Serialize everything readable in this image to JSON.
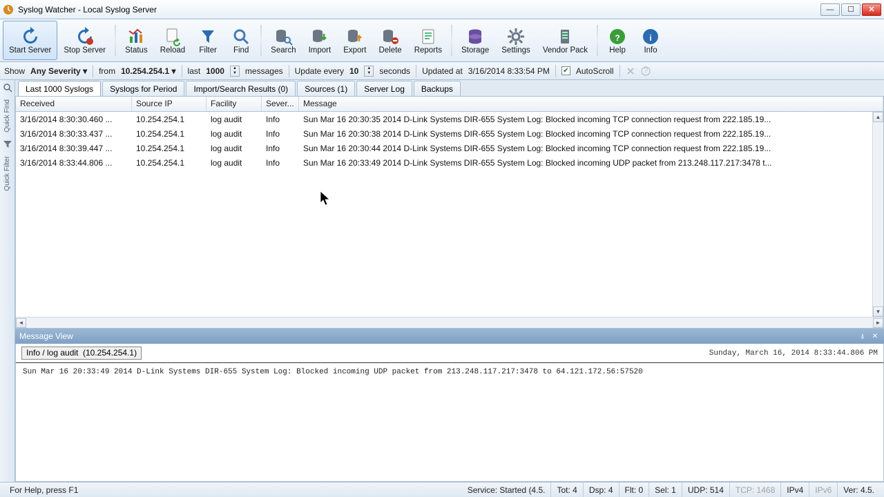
{
  "window": {
    "title": "Syslog Watcher - Local Syslog Server"
  },
  "toolbar": [
    {
      "name": "start-server",
      "label": "Start Server",
      "icon": "refresh-blue"
    },
    {
      "name": "stop-server",
      "label": "Stop Server",
      "icon": "refresh-red-dot"
    },
    {
      "name": "status",
      "label": "Status",
      "icon": "chart"
    },
    {
      "name": "reload",
      "label": "Reload",
      "icon": "page-refresh"
    },
    {
      "name": "filter",
      "label": "Filter",
      "icon": "funnel"
    },
    {
      "name": "find",
      "label": "Find",
      "icon": "magnify"
    },
    {
      "name": "search",
      "label": "Search",
      "icon": "db-search"
    },
    {
      "name": "import",
      "label": "Import",
      "icon": "db-import"
    },
    {
      "name": "export",
      "label": "Export",
      "icon": "db-export"
    },
    {
      "name": "delete",
      "label": "Delete",
      "icon": "db-delete"
    },
    {
      "name": "reports",
      "label": "Reports",
      "icon": "report"
    },
    {
      "name": "storage",
      "label": "Storage",
      "icon": "storage"
    },
    {
      "name": "settings",
      "label": "Settings",
      "icon": "gear"
    },
    {
      "name": "vendor-pack",
      "label": "Vendor Pack",
      "icon": "server"
    },
    {
      "name": "help",
      "label": "Help",
      "icon": "help"
    },
    {
      "name": "info",
      "label": "Info",
      "icon": "info"
    }
  ],
  "filterbar": {
    "show": "Show",
    "severity": "Any Severity",
    "from_lbl": "from",
    "from_ip": "10.254.254.1",
    "last_lbl": "last",
    "last_n": "1000",
    "messages": "messages",
    "update_every": "Update every",
    "update_n": "10",
    "seconds": "seconds",
    "updated_at_lbl": "Updated at",
    "updated_at": "3/16/2014 8:33:54 PM",
    "autoscroll": "AutoScroll"
  },
  "side": {
    "quick_find": "Quick Find",
    "quick_filter": "Quick Filter"
  },
  "tabs": [
    {
      "name": "last-syslogs",
      "label": "Last 1000 Syslogs",
      "active": true
    },
    {
      "name": "syslogs-period",
      "label": "Syslogs for Period",
      "active": false
    },
    {
      "name": "import-search",
      "label": "Import/Search Results (0)",
      "active": false
    },
    {
      "name": "sources",
      "label": "Sources (1)",
      "active": false
    },
    {
      "name": "server-log",
      "label": "Server Log",
      "active": false
    },
    {
      "name": "backups",
      "label": "Backups",
      "active": false
    }
  ],
  "columns": {
    "received": "Received",
    "ip": "Source IP",
    "facility": "Facility",
    "severity": "Sever...",
    "message": "Message"
  },
  "rows": [
    {
      "received": "3/16/2014 8:30:30.460 ...",
      "ip": "10.254.254.1",
      "facility": "log audit",
      "severity": "Info",
      "message": "Sun Mar 16 20:30:35 2014 D-Link Systems DIR-655 System Log: Blocked incoming TCP connection request from 222.185.19..."
    },
    {
      "received": "3/16/2014 8:30:33.437 ...",
      "ip": "10.254.254.1",
      "facility": "log audit",
      "severity": "Info",
      "message": "Sun Mar 16 20:30:38 2014 D-Link Systems DIR-655 System Log: Blocked incoming TCP connection request from 222.185.19..."
    },
    {
      "received": "3/16/2014 8:30:39.447 ...",
      "ip": "10.254.254.1",
      "facility": "log audit",
      "severity": "Info",
      "message": "Sun Mar 16 20:30:44 2014 D-Link Systems DIR-655 System Log: Blocked incoming TCP connection request from 222.185.19..."
    },
    {
      "received": "3/16/2014 8:33:44.806 ...",
      "ip": "10.254.254.1",
      "facility": "log audit",
      "severity": "Info",
      "message": "Sun Mar 16 20:33:49 2014 D-Link Systems DIR-655 System Log: Blocked incoming UDP packet from 213.248.117.217:3478 t..."
    }
  ],
  "msgview": {
    "title": "Message View",
    "tag": "Info / log audit",
    "host": "(10.254.254.1)",
    "date": "Sunday, March 16, 2014 8:33:44.806 PM",
    "body": "Sun Mar 16 20:33:49 2014 D-Link Systems DIR-655 System Log: Blocked incoming UDP packet from 213.248.117.217:3478 to 64.121.172.56:57520"
  },
  "status": {
    "help": "For Help, press F1",
    "service": "Service: Started (4.5.",
    "tot": "Tot: 4",
    "dsp": "Dsp: 4",
    "flt": "Flt: 0",
    "sel": "Sel: 1",
    "udp": "UDP: 514",
    "tcp": "TCP: 1468",
    "ipv4": "IPv4",
    "ipv6": "IPv6",
    "ver": "Ver: 4.5."
  }
}
